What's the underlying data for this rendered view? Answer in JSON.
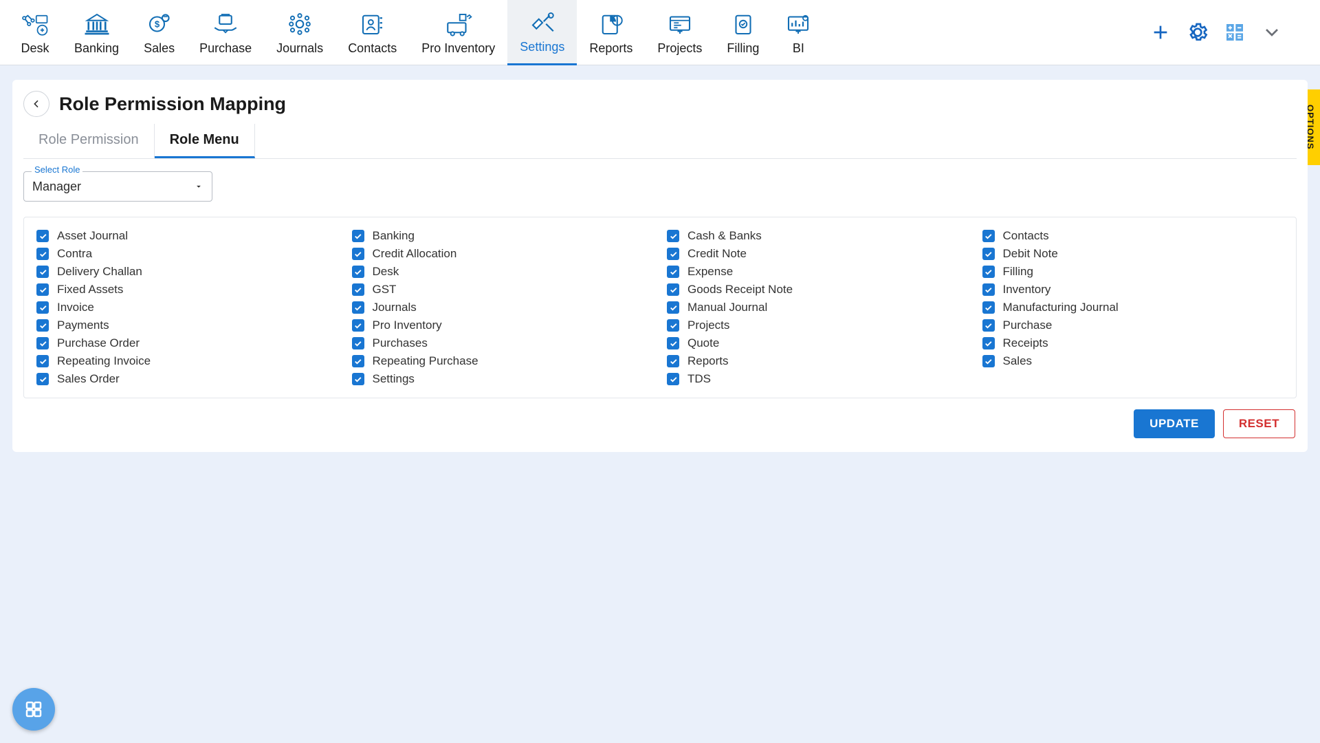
{
  "colors": {
    "primary": "#1976d2",
    "danger": "#d32f2f",
    "accent": "#ffcf00"
  },
  "topnav": {
    "items": [
      {
        "id": "desk",
        "label": "Desk",
        "active": false
      },
      {
        "id": "banking",
        "label": "Banking",
        "active": false
      },
      {
        "id": "sales",
        "label": "Sales",
        "active": false
      },
      {
        "id": "purchase",
        "label": "Purchase",
        "active": false
      },
      {
        "id": "journals",
        "label": "Journals",
        "active": false
      },
      {
        "id": "contacts",
        "label": "Contacts",
        "active": false
      },
      {
        "id": "proinventory",
        "label": "Pro Inventory",
        "active": false
      },
      {
        "id": "settings",
        "label": "Settings",
        "active": true
      },
      {
        "id": "reports",
        "label": "Reports",
        "active": false
      },
      {
        "id": "projects",
        "label": "Projects",
        "active": false
      },
      {
        "id": "filling",
        "label": "Filling",
        "active": false
      },
      {
        "id": "bi",
        "label": "BI",
        "active": false
      }
    ]
  },
  "page": {
    "title": "Role Permission Mapping"
  },
  "tabs": [
    {
      "id": "role-permission",
      "label": "Role Permission",
      "active": false
    },
    {
      "id": "role-menu",
      "label": "Role Menu",
      "active": true
    }
  ],
  "role_select": {
    "label": "Select Role",
    "value": "Manager"
  },
  "permissions": {
    "cols": [
      [
        {
          "label": "Asset Journal",
          "checked": true
        },
        {
          "label": "Contra",
          "checked": true
        },
        {
          "label": "Delivery Challan",
          "checked": true
        },
        {
          "label": "Fixed Assets",
          "checked": true
        },
        {
          "label": "Invoice",
          "checked": true
        },
        {
          "label": "Payments",
          "checked": true
        },
        {
          "label": "Purchase Order",
          "checked": true
        },
        {
          "label": "Repeating Invoice",
          "checked": true
        },
        {
          "label": "Sales Order",
          "checked": true
        }
      ],
      [
        {
          "label": "Banking",
          "checked": true
        },
        {
          "label": "Credit Allocation",
          "checked": true
        },
        {
          "label": "Desk",
          "checked": true
        },
        {
          "label": "GST",
          "checked": true
        },
        {
          "label": "Journals",
          "checked": true
        },
        {
          "label": "Pro Inventory",
          "checked": true
        },
        {
          "label": "Purchases",
          "checked": true
        },
        {
          "label": "Repeating Purchase",
          "checked": true
        },
        {
          "label": "Settings",
          "checked": true
        }
      ],
      [
        {
          "label": "Cash & Banks",
          "checked": true
        },
        {
          "label": "Credit Note",
          "checked": true
        },
        {
          "label": "Expense",
          "checked": true
        },
        {
          "label": "Goods Receipt Note",
          "checked": true
        },
        {
          "label": "Manual Journal",
          "checked": true
        },
        {
          "label": "Projects",
          "checked": true
        },
        {
          "label": "Quote",
          "checked": true
        },
        {
          "label": "Reports",
          "checked": true
        },
        {
          "label": "TDS",
          "checked": true
        }
      ],
      [
        {
          "label": "Contacts",
          "checked": true
        },
        {
          "label": "Debit Note",
          "checked": true
        },
        {
          "label": "Filling",
          "checked": true
        },
        {
          "label": "Inventory",
          "checked": true
        },
        {
          "label": "Manufacturing Journal",
          "checked": true
        },
        {
          "label": "Purchase",
          "checked": true
        },
        {
          "label": "Receipts",
          "checked": true
        },
        {
          "label": "Sales",
          "checked": true
        }
      ]
    ]
  },
  "actions": {
    "update": "UPDATE",
    "reset": "RESET"
  },
  "options_tab": {
    "label": "OPTIONS"
  }
}
